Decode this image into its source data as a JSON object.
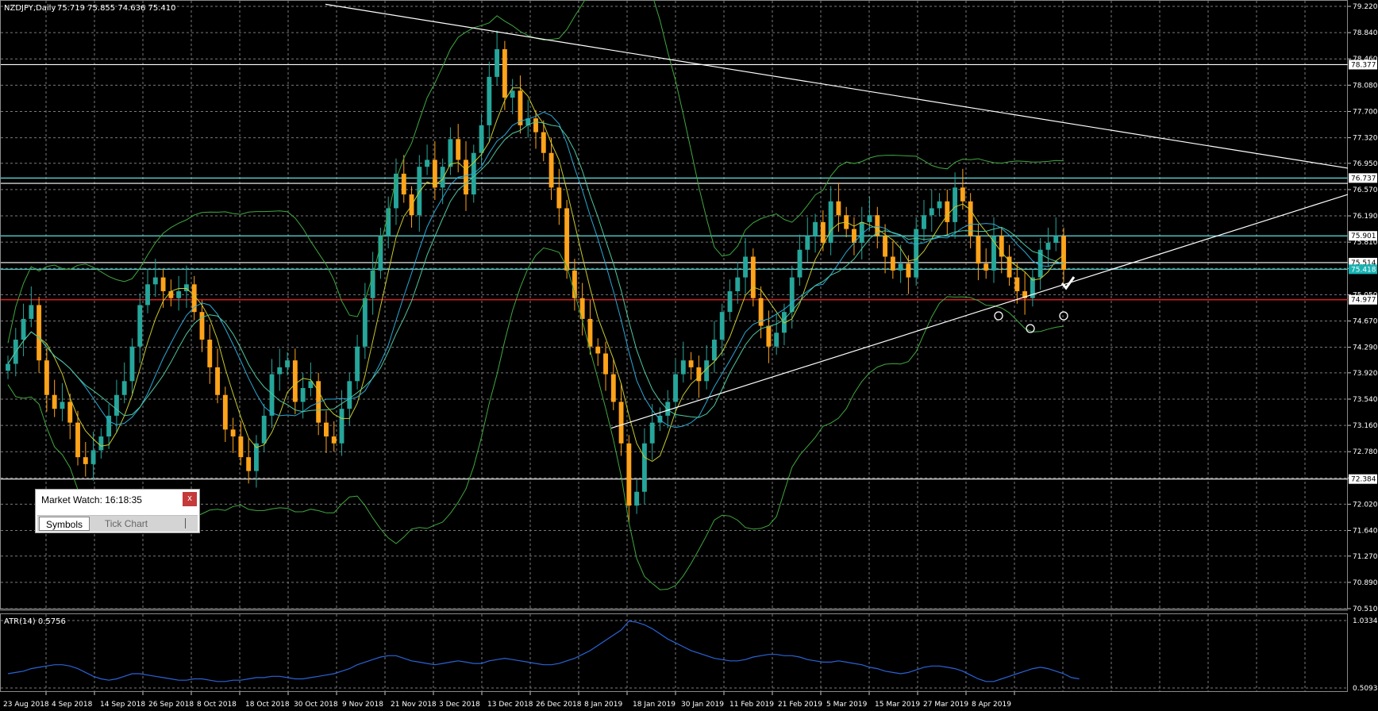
{
  "chart_header": {
    "symbol": "NZDJPY,Daily",
    "ohlc": "75.719 75.855 74.636 75.410"
  },
  "indicator_header": "ATR(14) 0.5756",
  "colors": {
    "background": "#000000",
    "grid": "#7a7a7a",
    "bull_candle": "#26a69a",
    "bear_candle": "#ffa31a",
    "ma_fast": "#c9c92e",
    "ma_slow_1": "#2aa8d6",
    "ma_slow_2": "#4ec6a0",
    "bollinger": "#3fa83f",
    "atr": "#2a63d6",
    "support_line": "#ff2020",
    "resistance_line": "#5fe0e0",
    "trendline": "#ffffff"
  },
  "price_axis": {
    "ticks": [
      "79.220",
      "78.840",
      "78.460",
      "78.080",
      "77.700",
      "77.320",
      "76.950",
      "76.570",
      "76.190",
      "75.810",
      "75.430",
      "75.050",
      "74.670",
      "74.290",
      "73.920",
      "73.540",
      "73.160",
      "72.780",
      "72.400",
      "72.020",
      "71.640",
      "71.270",
      "70.890",
      "70.510"
    ],
    "labels": [
      {
        "value": 78.377,
        "text": "78.377",
        "highlight": false
      },
      {
        "value": 76.737,
        "text": "76.737",
        "highlight": false
      },
      {
        "value": 75.901,
        "text": "75.901",
        "highlight": false
      },
      {
        "value": 75.514,
        "text": "75.514",
        "highlight": false
      },
      {
        "value": 75.418,
        "text": "75.418",
        "highlight": true
      },
      {
        "value": 74.977,
        "text": "74.977",
        "highlight": false
      },
      {
        "value": 72.384,
        "text": "72.384",
        "highlight": false
      }
    ]
  },
  "atr_axis": {
    "ticks": [
      "1.0334",
      "0.5093"
    ]
  },
  "date_axis": {
    "labels": [
      "23 Aug 2018",
      "4 Sep 2018",
      "14 Sep 2018",
      "26 Sep 2018",
      "8 Oct 2018",
      "18 Oct 2018",
      "30 Oct 2018",
      "9 Nov 2018",
      "21 Nov 2018",
      "3 Dec 2018",
      "13 Dec 2018",
      "26 Dec 2018",
      "8 Jan 2019",
      "18 Jan 2019",
      "30 Jan 2019",
      "11 Feb 2019",
      "21 Feb 2019",
      "5 Mar 2019",
      "15 Mar 2019",
      "27 Mar 2019",
      "8 Apr 2019"
    ]
  },
  "horizontal_levels": [
    {
      "value": 78.377,
      "kind": "white"
    },
    {
      "value": 76.737,
      "kind": "cyan"
    },
    {
      "value": 76.66,
      "kind": "white"
    },
    {
      "value": 75.901,
      "kind": "cyan"
    },
    {
      "value": 75.514,
      "kind": "white"
    },
    {
      "value": 75.418,
      "kind": "cyan"
    },
    {
      "value": 74.977,
      "kind": "red"
    },
    {
      "value": 72.384,
      "kind": "white"
    }
  ],
  "market_watch": {
    "title": "Market Watch: 16:18:35",
    "close_label": "x",
    "tabs": [
      {
        "label": "Symbols",
        "active": true
      },
      {
        "label": "Tick Chart",
        "active": false
      }
    ]
  },
  "chart_data": {
    "type": "candlestick",
    "symbol": "NZDJPY",
    "timeframe": "Daily",
    "ylim": [
      70.51,
      79.22
    ],
    "last_ohlc": {
      "open": 75.719,
      "high": 75.855,
      "low": 74.636,
      "close": 75.41
    },
    "atr_last": 0.5756,
    "atr_ylim": [
      0.5093,
      1.0334
    ],
    "closes": [
      74.05,
      74.4,
      74.7,
      74.9,
      74.1,
      73.6,
      73.4,
      73.5,
      73.2,
      72.7,
      72.6,
      72.8,
      73.0,
      73.3,
      73.6,
      73.8,
      74.3,
      74.9,
      75.2,
      75.3,
      75.1,
      75.0,
      75.1,
      75.2,
      74.8,
      74.4,
      74.0,
      73.6,
      73.1,
      73.0,
      72.7,
      72.5,
      72.9,
      73.3,
      73.9,
      74.0,
      74.1,
      73.5,
      73.7,
      73.8,
      73.2,
      73.0,
      72.9,
      73.4,
      73.8,
      74.3,
      75.0,
      75.4,
      75.9,
      76.3,
      76.8,
      76.5,
      76.2,
      76.9,
      77.0,
      76.6,
      76.9,
      77.3,
      77.0,
      76.5,
      77.1,
      77.5,
      78.2,
      78.6,
      77.9,
      78.0,
      77.5,
      77.6,
      77.4,
      77.1,
      76.6,
      76.3,
      75.4,
      75.0,
      74.7,
      74.3,
      74.2,
      73.9,
      73.5,
      72.9,
      72.0,
      72.2,
      72.9,
      73.2,
      73.3,
      73.5,
      73.9,
      74.1,
      74.0,
      73.8,
      74.1,
      74.4,
      74.8,
      75.1,
      75.3,
      75.6,
      75.0,
      74.6,
      74.3,
      74.5,
      74.8,
      75.3,
      75.7,
      75.9,
      76.1,
      75.8,
      76.4,
      76.2,
      76.0,
      75.8,
      76.1,
      76.2,
      75.9,
      75.6,
      75.4,
      75.5,
      75.3,
      76.0,
      76.2,
      76.3,
      76.4,
      76.1,
      76.6,
      76.4,
      75.9,
      75.5,
      75.4,
      75.9,
      75.6,
      75.3,
      75.1,
      75.0,
      75.3,
      75.7,
      75.8,
      75.9,
      75.41
    ],
    "atr": [
      0.62,
      0.63,
      0.64,
      0.66,
      0.67,
      0.68,
      0.69,
      0.69,
      0.68,
      0.66,
      0.63,
      0.6,
      0.58,
      0.57,
      0.58,
      0.6,
      0.62,
      0.62,
      0.61,
      0.6,
      0.59,
      0.58,
      0.57,
      0.57,
      0.58,
      0.58,
      0.57,
      0.56,
      0.56,
      0.57,
      0.57,
      0.58,
      0.59,
      0.59,
      0.6,
      0.6,
      0.59,
      0.58,
      0.58,
      0.59,
      0.6,
      0.61,
      0.62,
      0.64,
      0.66,
      0.69,
      0.71,
      0.73,
      0.75,
      0.76,
      0.76,
      0.74,
      0.72,
      0.71,
      0.7,
      0.69,
      0.7,
      0.71,
      0.72,
      0.71,
      0.7,
      0.7,
      0.72,
      0.73,
      0.74,
      0.73,
      0.72,
      0.71,
      0.7,
      0.69,
      0.69,
      0.7,
      0.72,
      0.74,
      0.77,
      0.8,
      0.84,
      0.88,
      0.92,
      0.96,
      1.03,
      1.02,
      1.0,
      0.97,
      0.93,
      0.89,
      0.86,
      0.83,
      0.8,
      0.78,
      0.76,
      0.74,
      0.73,
      0.72,
      0.72,
      0.73,
      0.75,
      0.76,
      0.77,
      0.77,
      0.76,
      0.76,
      0.75,
      0.73,
      0.72,
      0.71,
      0.71,
      0.72,
      0.71,
      0.7,
      0.69,
      0.67,
      0.66,
      0.64,
      0.63,
      0.62,
      0.63,
      0.65,
      0.67,
      0.68,
      0.68,
      0.67,
      0.66,
      0.64,
      0.61,
      0.58,
      0.56,
      0.56,
      0.58,
      0.6,
      0.62,
      0.64,
      0.66,
      0.67,
      0.66,
      0.64,
      0.62,
      0.59,
      0.58
    ]
  }
}
